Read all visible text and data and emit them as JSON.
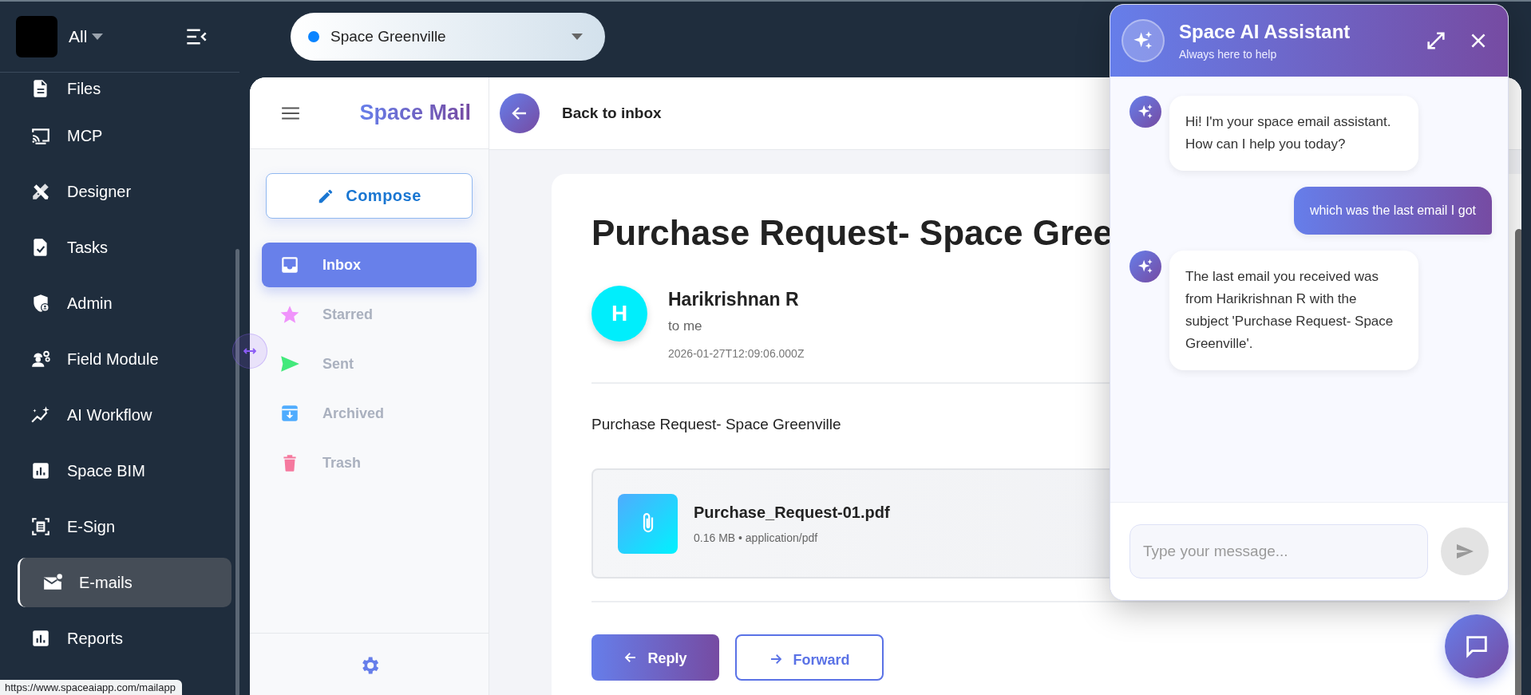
{
  "app": {
    "scope": "All"
  },
  "sidebar": {
    "items": [
      {
        "label": "Files",
        "selected": false
      },
      {
        "label": "MCP",
        "selected": false
      },
      {
        "label": "Designer",
        "selected": false
      },
      {
        "label": "Tasks",
        "selected": false
      },
      {
        "label": "Admin",
        "selected": false
      },
      {
        "label": "Field Module",
        "selected": false
      },
      {
        "label": "AI Workflow",
        "selected": false
      },
      {
        "label": "Space BIM",
        "selected": false
      },
      {
        "label": "E-Sign",
        "selected": false
      },
      {
        "label": "E-mails",
        "selected": true
      },
      {
        "label": "Reports",
        "selected": false
      }
    ]
  },
  "project_selector": {
    "value": "Space Greenville"
  },
  "mail": {
    "title": "Space Mail",
    "compose": "Compose",
    "folders": [
      {
        "label": "Inbox",
        "selected": true
      },
      {
        "label": "Starred",
        "selected": false
      },
      {
        "label": "Sent",
        "selected": false
      },
      {
        "label": "Archived",
        "selected": false
      },
      {
        "label": "Trash",
        "selected": false
      }
    ]
  },
  "email": {
    "back": "Back to inbox",
    "subject": "Purchase Request- Space Gree",
    "sender": {
      "initial": "H",
      "name": "Harikrishnan R",
      "to": "to me",
      "date": "2026-01-27T12:09:06.000Z"
    },
    "body": "Purchase Request- Space Greenville",
    "attachment": {
      "name": "Purchase_Request-01.pdf",
      "meta": "0.16 MB • application/pdf"
    },
    "actions": [
      {
        "label": "Reply",
        "kind": "primary"
      },
      {
        "label": "Forward",
        "kind": "secondary"
      }
    ]
  },
  "assistant": {
    "title": "Space AI Assistant",
    "subtitle": "Always here to help",
    "messages": [
      {
        "kind": "assistant",
        "text": "Hi! I'm your space email assistant. How can I help you today?"
      },
      {
        "kind": "user",
        "text": "which was the last email I got"
      },
      {
        "kind": "assistant",
        "text": "The last email you received was from Harikrishnan R with the subject 'Purchase Request- Space Greenville'."
      }
    ],
    "input": {
      "placeholder": "Type your message..."
    }
  },
  "status_bar": {
    "url": "https://www.spaceaiapp.com/mailapp"
  }
}
